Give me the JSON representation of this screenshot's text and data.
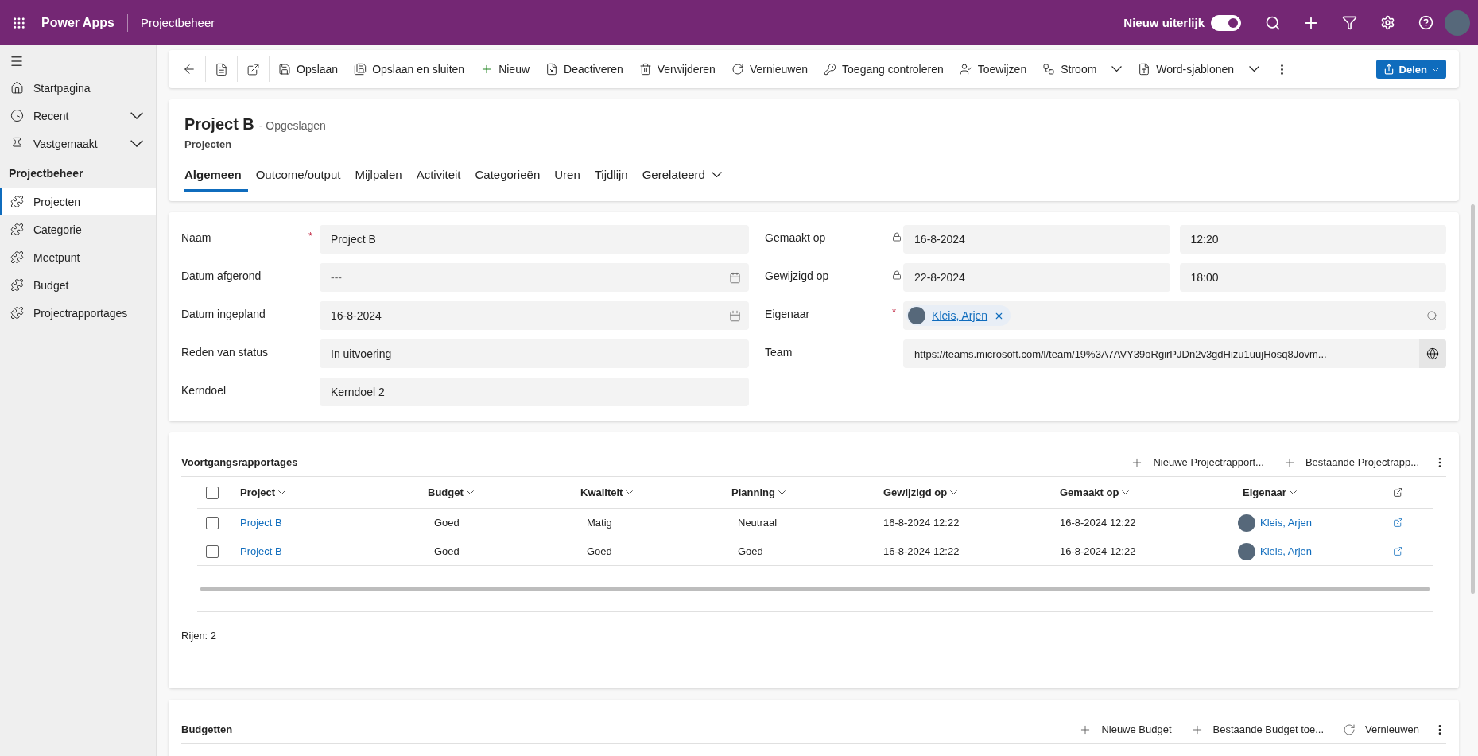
{
  "topbar": {
    "app_name": "Power Apps",
    "area": "Projectbeheer",
    "toggle": {
      "label": "Nieuw uiterlijk",
      "on": true
    }
  },
  "sidebar": {
    "items": [
      {
        "label": "Startpagina",
        "expandable": false
      },
      {
        "label": "Recent",
        "expandable": true
      },
      {
        "label": "Vastgemaakt",
        "expandable": true
      }
    ],
    "group": {
      "title": "Projectbeheer",
      "items": [
        {
          "label": "Projecten",
          "selected": true
        },
        {
          "label": "Categorie",
          "selected": false
        },
        {
          "label": "Meetpunt",
          "selected": false
        },
        {
          "label": "Budget",
          "selected": false
        },
        {
          "label": "Projectrapportages",
          "selected": false
        }
      ]
    }
  },
  "commandbar": {
    "commands": [
      {
        "label": "Opslaan",
        "dropdown": false
      },
      {
        "label": "Opslaan en sluiten",
        "dropdown": false
      },
      {
        "label": "Nieuw",
        "dropdown": false
      },
      {
        "label": "Deactiveren",
        "dropdown": false
      },
      {
        "label": "Verwijderen",
        "dropdown": false
      },
      {
        "label": "Vernieuwen",
        "dropdown": false
      },
      {
        "label": "Toegang controleren",
        "dropdown": false
      },
      {
        "label": "Toewijzen",
        "dropdown": false
      },
      {
        "label": "Stroom",
        "dropdown": true
      },
      {
        "label": "Word-sjablonen",
        "dropdown": true
      }
    ],
    "share": {
      "label": "Delen"
    }
  },
  "record": {
    "title": "Project B",
    "status": "- Opgeslagen",
    "entity": "Projecten",
    "tabs": [
      {
        "label": "Algemeen",
        "selected": true,
        "dropdown": false
      },
      {
        "label": "Outcome/output",
        "selected": false,
        "dropdown": false
      },
      {
        "label": "Mijlpalen",
        "selected": false,
        "dropdown": false
      },
      {
        "label": "Activiteit",
        "selected": false,
        "dropdown": false
      },
      {
        "label": "Categorieën",
        "selected": false,
        "dropdown": false
      },
      {
        "label": "Uren",
        "selected": false,
        "dropdown": false
      },
      {
        "label": "Tijdlijn",
        "selected": false,
        "dropdown": false
      },
      {
        "label": "Gerelateerd",
        "selected": false,
        "dropdown": true
      }
    ]
  },
  "form": {
    "left": [
      {
        "label": "Naam",
        "marker": "*",
        "kind": "text",
        "value": "Project B"
      },
      {
        "label": "Datum afgerond",
        "kind": "date",
        "placeholder": "---"
      },
      {
        "label": "Datum ingepland",
        "kind": "date",
        "value": "16-8-2024"
      },
      {
        "label": "Reden van status",
        "kind": "text",
        "value": "In uitvoering"
      },
      {
        "label": "Kerndoel",
        "kind": "text",
        "value": "Kerndoel 2"
      }
    ],
    "right": [
      {
        "label": "Gemaakt op",
        "locked": true,
        "kind": "datetime",
        "date": "16-8-2024",
        "time": "12:20"
      },
      {
        "label": "Gewijzigd op",
        "locked": true,
        "kind": "datetime",
        "date": "22-8-2024",
        "time": "18:00"
      },
      {
        "label": "Eigenaar",
        "marker": "*",
        "locked": false,
        "kind": "lookup",
        "value": "Kleis, Arjen"
      },
      {
        "label": "Team",
        "locked": false,
        "kind": "url",
        "value": "https://teams.microsoft.com/l/team/19%3A7AVY39oRgirPJDn2v3gdHizu1uujHosq8Jovm..."
      }
    ]
  },
  "reports": {
    "title": "Voortgangsrapportages",
    "commands": [
      {
        "kind": "add",
        "label": "Nieuwe Projectrapport..."
      },
      {
        "kind": "add",
        "label": "Bestaande Projectrapp..."
      }
    ],
    "all_selected": false,
    "columns": [
      {
        "label": "Project"
      },
      {
        "label": "Budget"
      },
      {
        "label": "Kwaliteit"
      },
      {
        "label": "Planning"
      },
      {
        "label": "Gewijzigd op"
      },
      {
        "label": "Gemaakt op"
      },
      {
        "label": "Eigenaar"
      }
    ],
    "rows": [
      {
        "selected": false,
        "cells": [
          "Project B",
          "Goed",
          "Matig",
          "Neutraal",
          "16-8-2024 12:22",
          "16-8-2024 12:22",
          "Kleis, Arjen"
        ]
      },
      {
        "selected": false,
        "cells": [
          "Project B",
          "Goed",
          "Goed",
          "Goed",
          "16-8-2024 12:22",
          "16-8-2024 12:22",
          "Kleis, Arjen"
        ]
      }
    ],
    "footer": "Rijen: 2"
  },
  "budgets": {
    "title": "Budgetten",
    "commands": [
      {
        "kind": "add",
        "label": "Nieuwe Budget"
      },
      {
        "kind": "add",
        "label": "Bestaande Budget toe..."
      },
      {
        "kind": "refresh",
        "label": "Vernieuwen"
      }
    ]
  }
}
